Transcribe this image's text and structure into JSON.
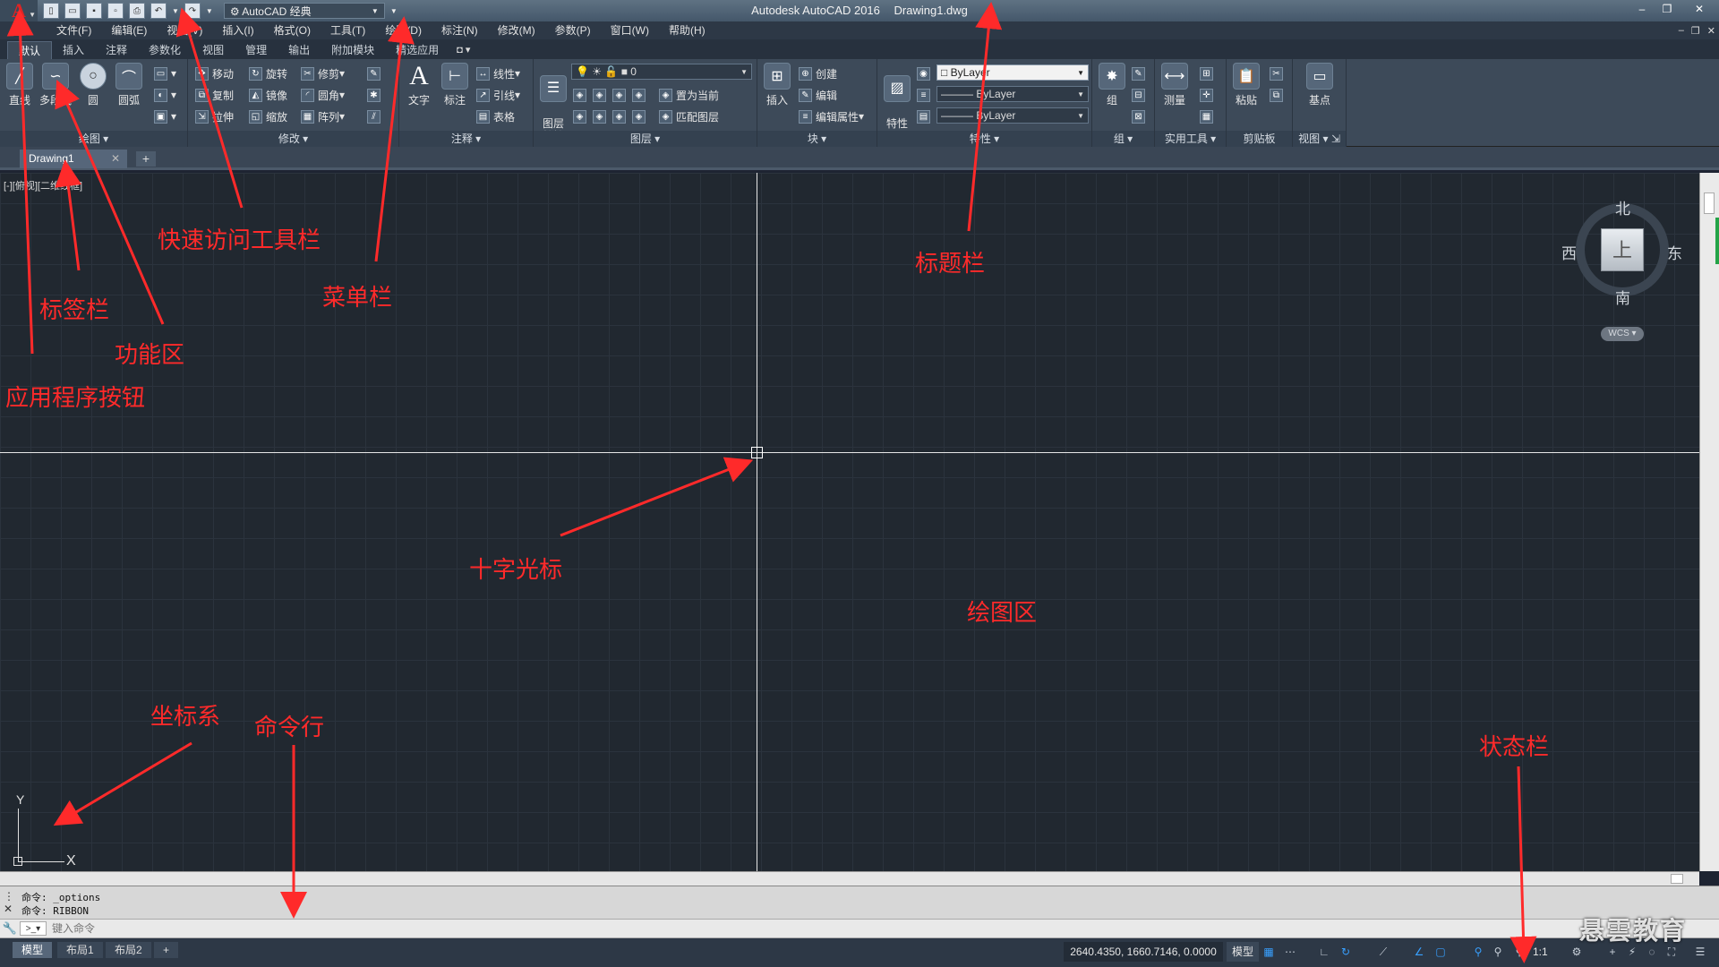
{
  "app": {
    "logo_glyph": "A",
    "title": "Autodesk AutoCAD 2016",
    "document": "Drawing1.dwg",
    "workspace": "AutoCAD 经典"
  },
  "quick_access": {
    "icons": [
      "new-icon",
      "open-icon",
      "save-icon",
      "saveas-icon",
      "print-icon",
      "undo-icon",
      "redo-icon"
    ]
  },
  "window_controls": {
    "minimize": "–",
    "restore": "❐",
    "close": "✕"
  },
  "menu": {
    "items": [
      "文件(F)",
      "编辑(E)",
      "视图(V)",
      "插入(I)",
      "格式(O)",
      "工具(T)",
      "绘图(D)",
      "标注(N)",
      "修改(M)",
      "参数(P)",
      "窗口(W)",
      "帮助(H)"
    ]
  },
  "ribbon_tabs": {
    "items": [
      "默认",
      "插入",
      "注释",
      "参数化",
      "视图",
      "管理",
      "输出",
      "附加模块",
      "精选应用"
    ],
    "active_index": 0
  },
  "ribbon": {
    "draw": {
      "label": "绘图",
      "line": "直线",
      "polyline": "多段线",
      "circle": "圆",
      "arc": "圆弧"
    },
    "modify": {
      "label": "修改",
      "move": "移动",
      "rotate": "旋转",
      "trim": "修剪",
      "copy": "复制",
      "mirror": "镜像",
      "fillet": "圆角",
      "stretch": "拉伸",
      "scale": "缩放",
      "array": "阵列"
    },
    "annotation": {
      "label": "注释",
      "text": "文字",
      "dimension": "标注",
      "linear": "线性",
      "leader": "引线",
      "table": "表格"
    },
    "layers": {
      "label": "图层",
      "layer_properties": "图层\n特性",
      "current_layer": "0",
      "set_current": "置为当前",
      "match_layer": "匹配图层"
    },
    "block": {
      "label": "块",
      "insert": "插入",
      "create": "创建",
      "edit": "编辑",
      "edit_attributes": "编辑属性"
    },
    "properties": {
      "label": "特性",
      "match": "特性\n匹配",
      "color": "ByLayer",
      "linetype": "ByLayer",
      "lineweight": "ByLayer"
    },
    "groups": {
      "label": "组",
      "group": "组"
    },
    "utilities": {
      "label": "实用工具",
      "measure": "测量"
    },
    "clipboard": {
      "label": "剪贴板",
      "paste": "粘贴"
    },
    "view": {
      "label": "视图",
      "base": "基点"
    }
  },
  "file_tabs": {
    "active": "Drawing1",
    "close": "✕",
    "add": "+"
  },
  "viewport": {
    "label": "[-][俯视][二维线框]"
  },
  "viewcube": {
    "north": "北",
    "south": "南",
    "east": "东",
    "west": "西",
    "face": "上",
    "wcs": "WCS"
  },
  "ucs": {
    "x": "X",
    "y": "Y"
  },
  "command": {
    "history": [
      "命令: _options",
      "命令: RIBBON"
    ],
    "placeholder": "键入命令"
  },
  "status": {
    "layouts": [
      "模型",
      "布局1",
      "布局2"
    ],
    "coordinates": "2640.4350, 1660.7146, 0.0000",
    "model": "模型",
    "scale": "1:1"
  },
  "watermark": "悬雲教育",
  "annotations": {
    "app_button": "应用程序按钮",
    "tab_bar": "标签栏",
    "ribbon": "功能区",
    "quick_access": "快速访问工具栏",
    "menubar": "菜单栏",
    "titlebar": "标题栏",
    "crosshair": "十字光标",
    "drawing_area": "绘图区",
    "ucs": "坐标系",
    "command_line": "命令行",
    "status_bar": "状态栏"
  },
  "colors": {
    "annotation": "#ff2a2a",
    "drawing_bg": "#212830",
    "ribbon_bg": "#3d4a59",
    "logo": "#e02424"
  }
}
